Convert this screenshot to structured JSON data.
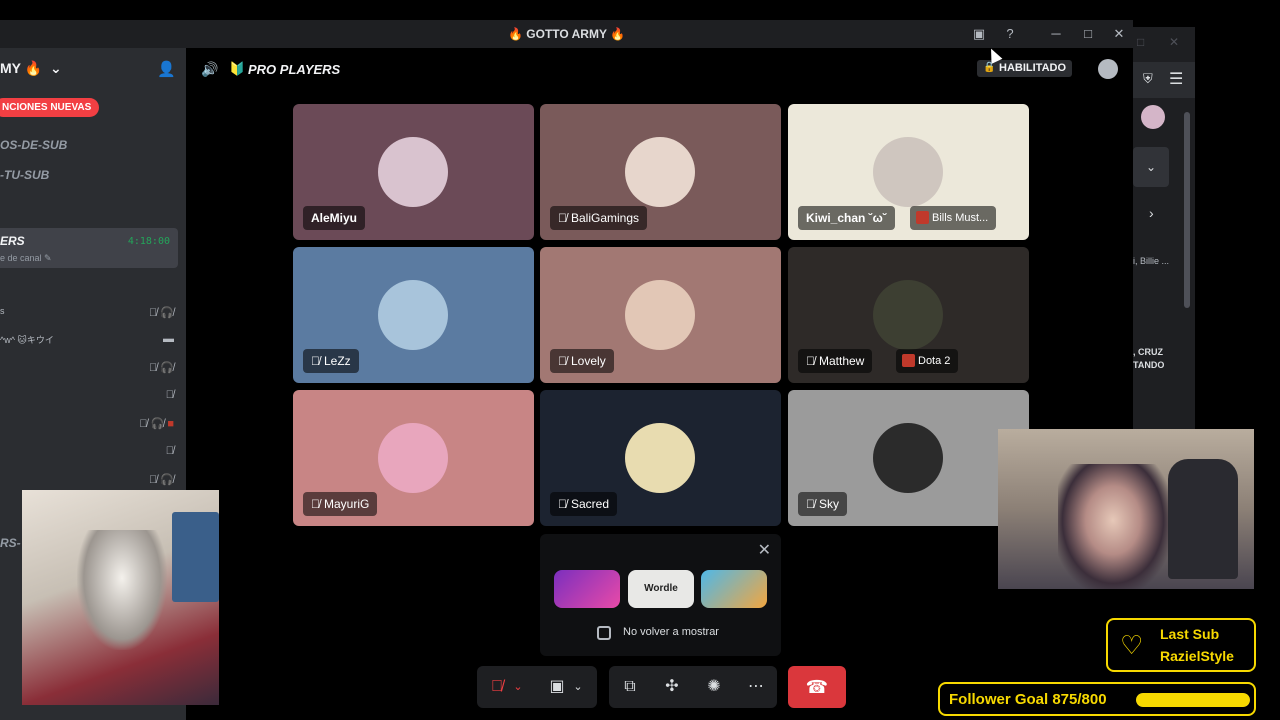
{
  "window": {
    "title": "🔥 GOTTO ARMY 🔥"
  },
  "sidebar": {
    "server_name": "MY 🔥",
    "mentions_pill": "NCIONES NUEVAS",
    "channels": [
      "OS-DE-SUB",
      "-TU-SUB"
    ],
    "active_channel": {
      "name": "ERS",
      "timer": "4:18:00",
      "subtext": "e de canal"
    },
    "member_row_text": "^w^ 🐱キウイ",
    "lower_channel": "RS-"
  },
  "voice": {
    "title": "PRO PLAYERS",
    "status_badge": "HABILITADO",
    "participants": [
      {
        "name": "AleMiyu",
        "muted": false,
        "bg": "#6b4a57",
        "avatar_color": "#d9c3cf"
      },
      {
        "name": "BaliGamings",
        "muted": true,
        "bg": "#7a5a5a",
        "avatar_color": "#e7d6cc"
      },
      {
        "name": "Kiwi_chan ˘ω˘",
        "muted": false,
        "bg": "#ece8da",
        "avatar_color": "#cfc6bf",
        "activity": "Bills Must..."
      },
      {
        "name": "LeZz",
        "muted": true,
        "bg": "#5b7ba1",
        "avatar_color": "#a8c4db"
      },
      {
        "name": "Lovely",
        "muted": true,
        "bg": "#a27873",
        "avatar_color": "#e2c7b6"
      },
      {
        "name": "Matthew",
        "muted": true,
        "bg": "#2e2a28",
        "avatar_color": "#3d3f32",
        "activity": "Dota 2"
      },
      {
        "name": "MayuriG",
        "muted": true,
        "bg": "#c88585",
        "avatar_color": "#e8a6bd"
      },
      {
        "name": "Sacred",
        "muted": true,
        "bg": "#1c2330",
        "avatar_color": "#e8dcb0"
      },
      {
        "name": "Sky",
        "muted": true,
        "bg": "#9b9b9b",
        "avatar_color": "#2b2b2b"
      }
    ]
  },
  "promo": {
    "games": [
      "",
      "Wordle",
      ""
    ],
    "checkbox_label": "No volver a mostrar"
  },
  "right_panel": {
    "line1": "i, Billie ...",
    "line2": ", CRUZ",
    "line3": "TANDO"
  },
  "overlay": {
    "last_sub_title": "Last Sub",
    "last_sub_name": "RazielStyle",
    "follower_goal": "Follower Goal 875/800",
    "follower_goal_fraction": 1.0
  },
  "colors": {
    "accent_yellow": "#f7d900",
    "hangup_red": "#da373c",
    "online_green": "#23a55a"
  }
}
